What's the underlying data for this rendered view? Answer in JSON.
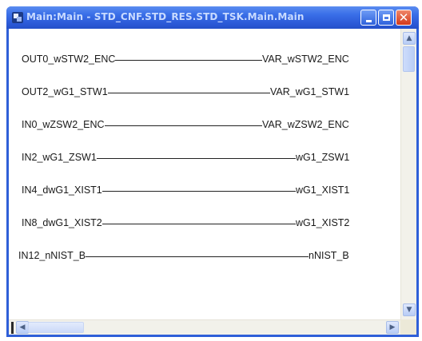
{
  "window": {
    "title": "Main:Main - STD_CNF.STD_RES.STD_TSK.Main.Main"
  },
  "connections": [
    {
      "input": "OUT0_wSTW2_ENC",
      "output": "VAR_wSTW2_ENC"
    },
    {
      "input": "OUT2_wG1_STW1",
      "output": "VAR_wG1_STW1"
    },
    {
      "input": "IN0_wZSW2_ENC",
      "output": "VAR_wZSW2_ENC"
    },
    {
      "input": "IN2_wG1_ZSW1",
      "output": "wG1_ZSW1"
    },
    {
      "input": "IN4_dwG1_XIST1",
      "output": "wG1_XIST1"
    },
    {
      "input": "IN8_dwG1_XIST2",
      "output": "wG1_XIST2"
    },
    {
      "input": "IN12_nNIST_B",
      "output": "nNIST_B"
    }
  ],
  "scrollbars": {
    "up_arrow": "▲",
    "down_arrow": "▼",
    "left_arrow": "◀",
    "right_arrow": "▶"
  },
  "titlebar_buttons": {
    "minimize_icon": "minimize-icon",
    "maximize_icon": "maximize-icon",
    "close_glyph": "✕"
  },
  "colors": {
    "titlebar": "#2a58d6",
    "close_button": "#d2391b",
    "canvas": "#ffffff"
  }
}
